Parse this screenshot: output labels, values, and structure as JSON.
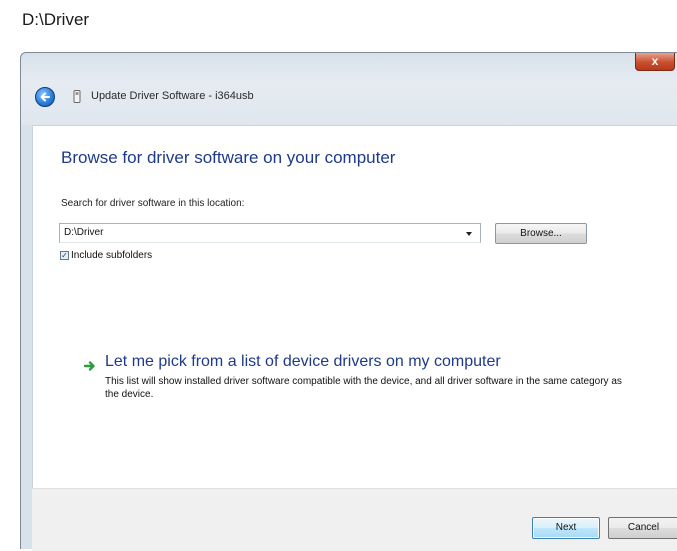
{
  "caption": "D:\\Driver",
  "window": {
    "title": "Update Driver Software - i364usb",
    "close_label": "x"
  },
  "content": {
    "heading": "Browse for driver software on your computer",
    "search_label": "Search for driver software in this location:",
    "path_value": "D:\\Driver",
    "browse_label": "Browse...",
    "include_subfolders_label": "Include subfolders",
    "include_subfolders_checked": true,
    "option_title": "Let me pick from a list of device drivers on my computer",
    "option_desc": "This list will show installed driver software compatible with the device, and all driver software in the same category as the device."
  },
  "footer": {
    "next_label": "Next",
    "cancel_label": "Cancel"
  },
  "icons": {
    "back": "back-arrow-icon",
    "title": "device-icon",
    "option": "green-arrow-icon",
    "dropdown": "chevron-down-icon"
  },
  "colors": {
    "heading": "#1e3a8a",
    "close": "#c8502f",
    "option_arrow": "#2e9e3a"
  }
}
